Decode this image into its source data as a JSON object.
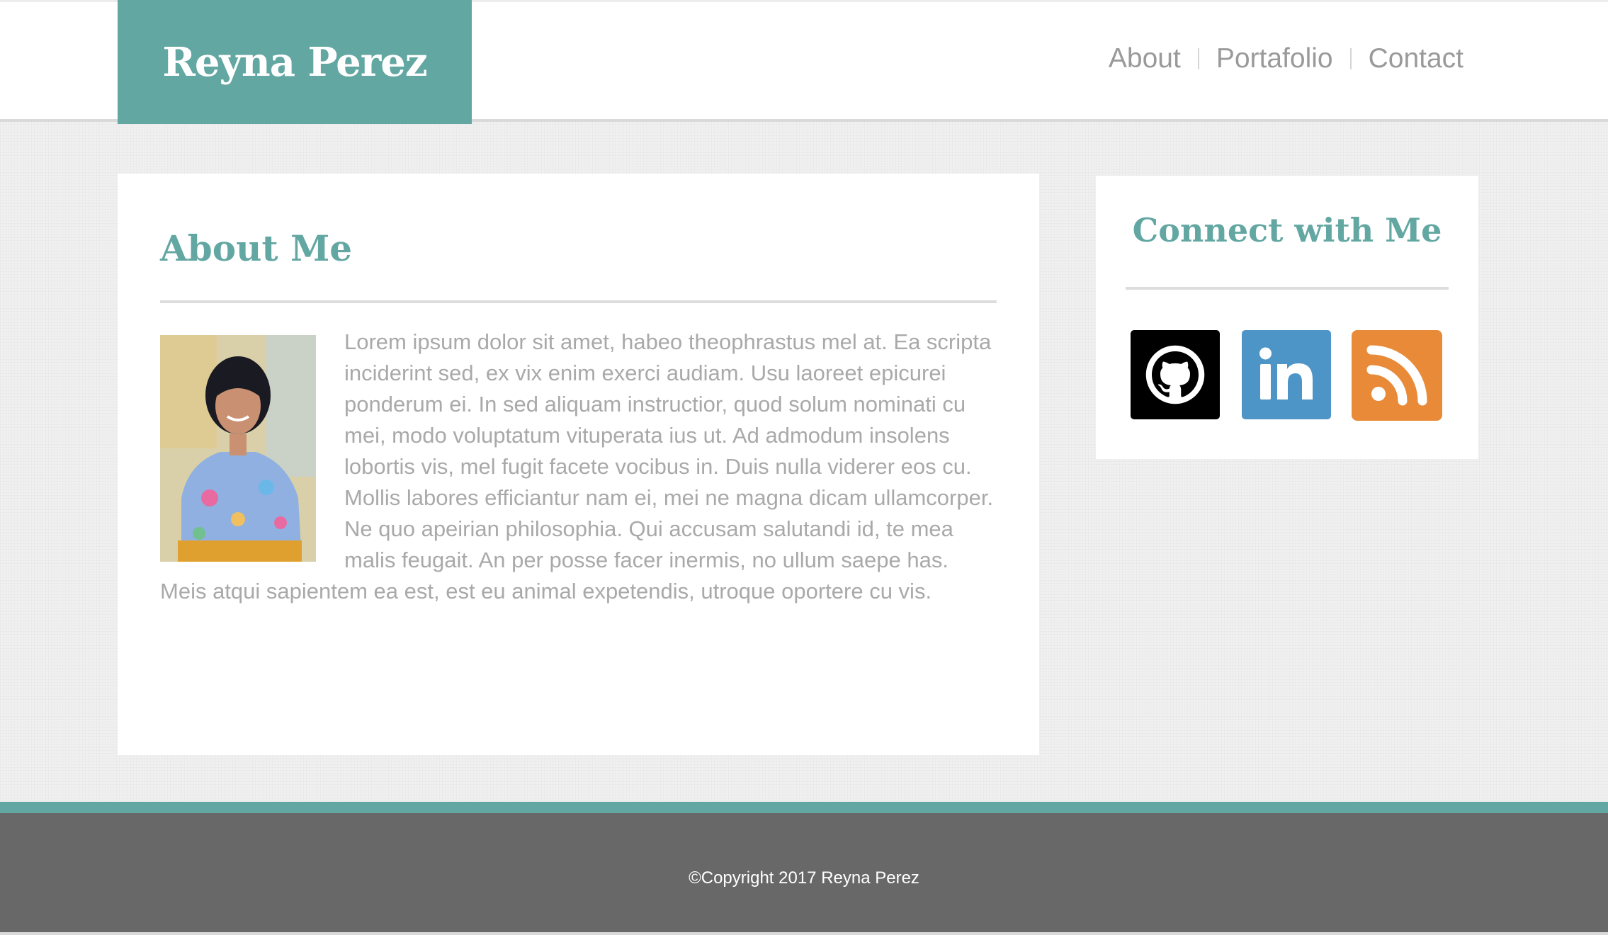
{
  "header": {
    "brand": "Reyna Perez",
    "nav": [
      {
        "label": "About"
      },
      {
        "label": "Portafolio"
      },
      {
        "label": "Contact"
      }
    ]
  },
  "main": {
    "title": "About Me",
    "body": "Lorem ipsum dolor sit amet, habeo theophrastus mel at. Ea scripta inciderint sed, ex vix enim exerci audiam. Usu laoreet epicurei ponderum ei. In sed aliquam instructior, quod solum nominati cu mei, modo voluptatum vituperata ius ut. Ad admodum insolens lobortis vis, mel fugit facete vocibus in. Duis nulla viderer eos cu. Mollis labores efficiantur nam ei, mei ne magna dicam ullamcorper. Ne quo apeirian philosophia. Qui accusam salutandi id, te mea malis feugait. An per posse facer inermis, no ullum saepe has. Meis atqui sapientem ea est, est eu animal expetendis, utroque oportere cu vis."
  },
  "sidebar": {
    "title": "Connect with Me",
    "social": [
      {
        "icon": "github-icon",
        "color": "#000000"
      },
      {
        "icon": "linkedin-icon",
        "color": "#4e95c7"
      },
      {
        "icon": "rss-icon",
        "color": "#e98a38"
      }
    ]
  },
  "footer": {
    "copyright": "©Copyright 2017 Reyna Perez"
  },
  "colors": {
    "accent": "#63a7a2",
    "footer": "#686868",
    "text_muted": "#a9a9a9"
  }
}
